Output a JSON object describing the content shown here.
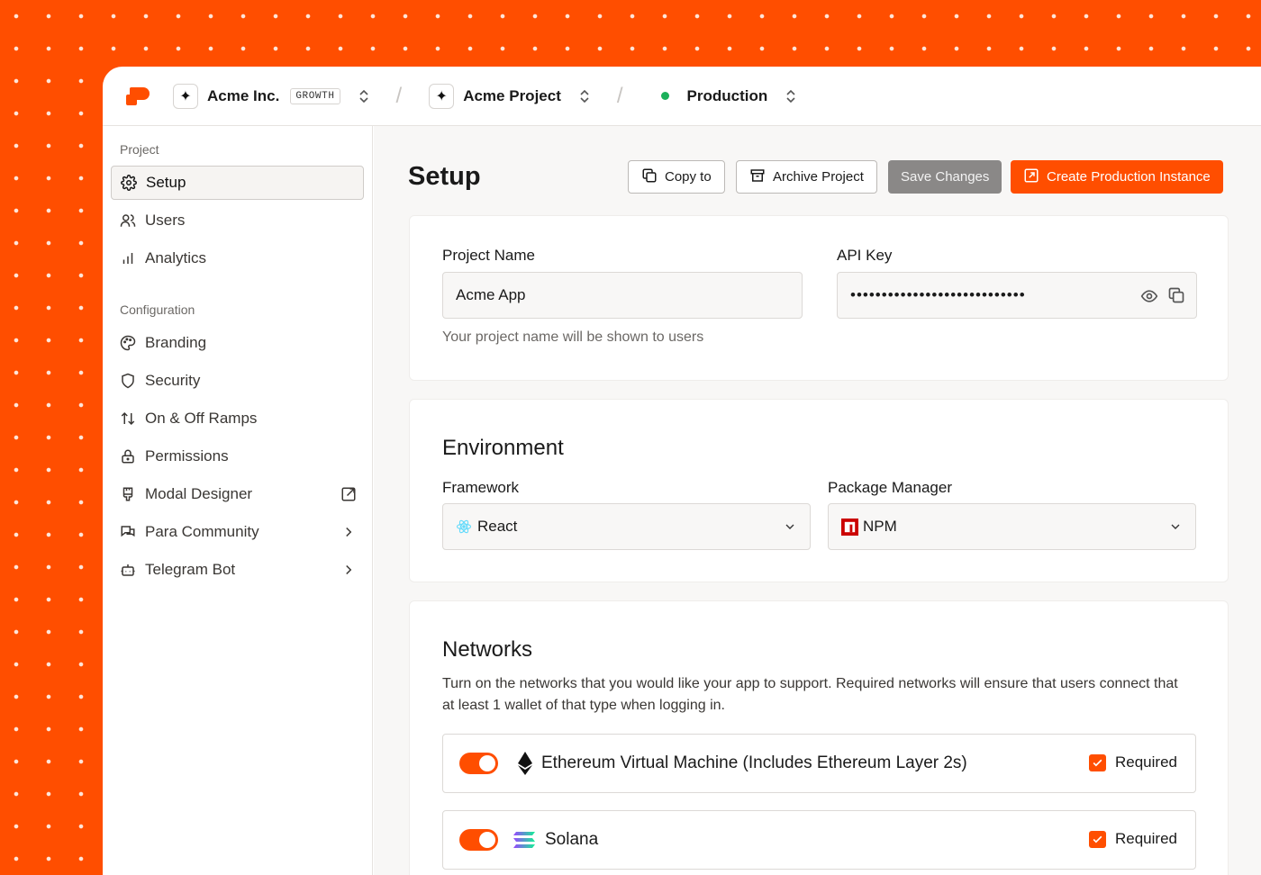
{
  "topbar": {
    "org_name": "Acme Inc.",
    "org_plan": "GROWTH",
    "project_name": "Acme Project",
    "environment": "Production"
  },
  "sidebar": {
    "project_section": "Project",
    "project_items": [
      {
        "label": "Setup",
        "icon": "gear-icon",
        "active": true
      },
      {
        "label": "Users",
        "icon": "users-icon"
      },
      {
        "label": "Analytics",
        "icon": "bar-chart-icon"
      }
    ],
    "config_section": "Configuration",
    "config_items": [
      {
        "label": "Branding",
        "icon": "palette-icon"
      },
      {
        "label": "Security",
        "icon": "shield-icon"
      },
      {
        "label": "On & Off Ramps",
        "icon": "arrows-updown-icon"
      },
      {
        "label": "Permissions",
        "icon": "lock-icon"
      },
      {
        "label": "Modal Designer",
        "icon": "brush-icon",
        "trail": "external-link-icon"
      },
      {
        "label": "Para Community",
        "icon": "chat-icon",
        "trail": "chevron-right-icon"
      },
      {
        "label": "Telegram Bot",
        "icon": "bot-icon",
        "trail": "chevron-right-icon"
      }
    ]
  },
  "main": {
    "title": "Setup",
    "copy_to": "Copy to",
    "archive": "Archive Project",
    "save": "Save Changes",
    "create_prod": "Create Production Instance",
    "project_name_label": "Project Name",
    "project_name_value": "Acme App",
    "project_name_hint": "Your project name will be shown to users",
    "api_key_label": "API Key",
    "api_key_value": "••••••••••••••••••••••••••••",
    "environment_heading": "Environment",
    "framework_label": "Framework",
    "framework_value": "React",
    "package_manager_label": "Package Manager",
    "package_manager_value": "NPM",
    "networks_heading": "Networks",
    "networks_desc": "Turn on the networks that you would like your app to support. Required networks will ensure that users connect that at least 1 wallet of that type when logging in.",
    "networks": [
      {
        "name": "Ethereum Virtual Machine (Includes Ethereum Layer 2s)",
        "enabled": true,
        "required_label": "Required",
        "required": true,
        "icon": "ethereum-icon"
      },
      {
        "name": "Solana",
        "enabled": true,
        "required_label": "Required",
        "required": true,
        "icon": "solana-icon"
      }
    ]
  },
  "colors": {
    "brand": "#FF4E00",
    "status_green": "#1bb05a",
    "gray_button": "#8a8887"
  }
}
